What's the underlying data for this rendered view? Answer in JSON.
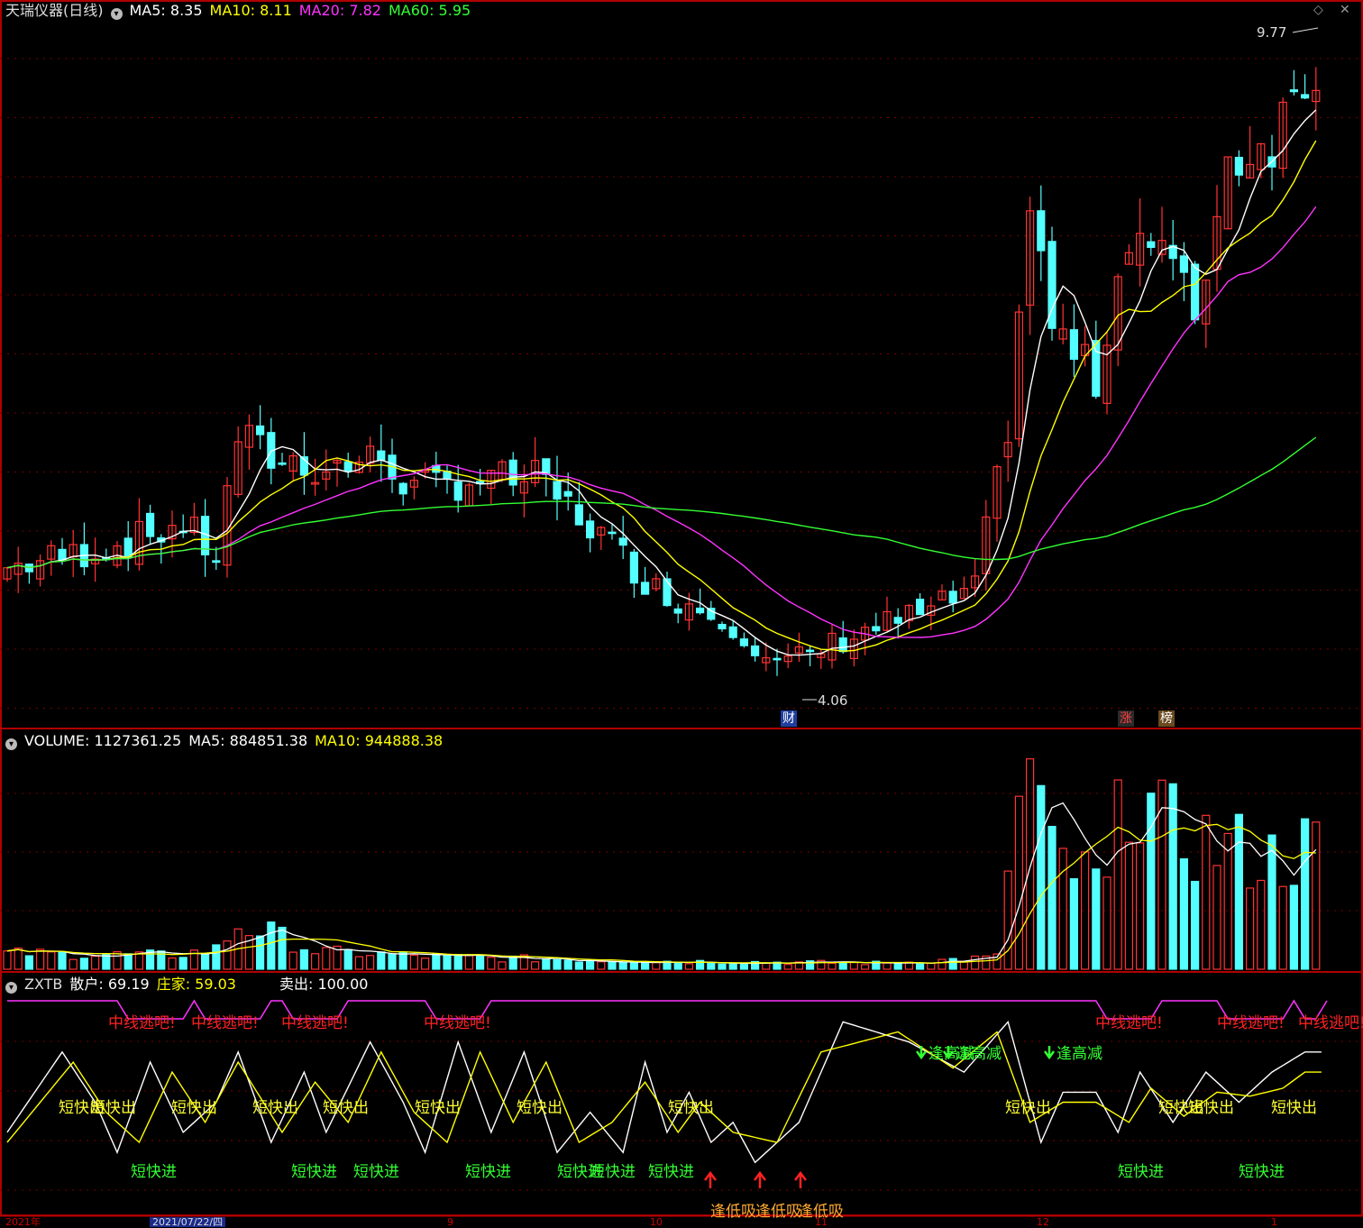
{
  "price_panel": {
    "title": "天瑞仪器(日线)",
    "indicators": [
      {
        "label": "MA5: 8.35",
        "color": "#ffffff"
      },
      {
        "label": "MA10: 8.11",
        "color": "#ffff00"
      },
      {
        "label": "MA20: 7.82",
        "color": "#ff33ff"
      },
      {
        "label": "MA60: 5.95",
        "color": "#33ff33"
      }
    ],
    "high_label": "9.77",
    "low_label": "4.06",
    "badge_cai": "财",
    "badge_zhang": "涨",
    "badge_bang": "榜"
  },
  "volume_panel": {
    "indicators": [
      {
        "label": "VOLUME: 1127361.25",
        "color": "#ffffff"
      },
      {
        "label": "MA5: 884851.38",
        "color": "#ffffff"
      },
      {
        "label": "MA10: 944888.38",
        "color": "#ffff00"
      }
    ]
  },
  "zxtb_panel": {
    "name": "ZXTB",
    "indicators": [
      {
        "label": "散户: 69.19",
        "color": "#ffffff"
      },
      {
        "label": "庄家: 59.03",
        "color": "#ffff00"
      },
      {
        "label": "卖出: 100.00",
        "color": "#ffffff"
      }
    ],
    "signal_escape": "中线逃吧!",
    "signal_short_out": "短快出",
    "signal_short_in": "短快进",
    "signal_reduce": "逢高减",
    "signal_low_buy": "逢低吸"
  },
  "x_axis": {
    "labels": [
      "2021年",
      "2021/07/22/四",
      "9",
      "10",
      "11",
      "12",
      "1"
    ]
  },
  "colors": {
    "up": "#ff3333",
    "down": "#54ffff",
    "ma5": "#ffffff",
    "ma10": "#ffff00",
    "ma20": "#ff33ff",
    "ma60": "#33ff33",
    "border": "#b00000",
    "signal_red": "#ff2222",
    "signal_yellow": "#ffff33",
    "signal_green": "#33ff33",
    "signal_magenta": "#ff33ff"
  },
  "chart_data": [
    {
      "type": "candlestick",
      "title": "天瑞仪器(日线)",
      "x_range": [
        0,
        120
      ],
      "ylim": [
        3.7,
        10.1
      ],
      "series_ma": [
        "MA5",
        "MA10",
        "MA20",
        "MA60"
      ],
      "price_high": 9.77,
      "price_low": 4.06,
      "close_anchors": [
        [
          0,
          5.1
        ],
        [
          10,
          5.3
        ],
        [
          16,
          5.5
        ],
        [
          19,
          5.2
        ],
        [
          21,
          6.3
        ],
        [
          24,
          6.1
        ],
        [
          29,
          6.0
        ],
        [
          34,
          6.1
        ],
        [
          37,
          5.8
        ],
        [
          42,
          5.9
        ],
        [
          48,
          5.9
        ],
        [
          54,
          5.4
        ],
        [
          59,
          4.9
        ],
        [
          66,
          4.6
        ],
        [
          70,
          4.2
        ],
        [
          73,
          4.3
        ],
        [
          77,
          4.5
        ],
        [
          84,
          4.7
        ],
        [
          88,
          4.9
        ],
        [
          91,
          6.4
        ],
        [
          93,
          8.4
        ],
        [
          95,
          7.3
        ],
        [
          99,
          6.8
        ],
        [
          102,
          8.2
        ],
        [
          105,
          8.0
        ],
        [
          108,
          7.4
        ],
        [
          111,
          8.8
        ],
        [
          115,
          9.0
        ],
        [
          118,
          9.6
        ]
      ]
    },
    {
      "type": "bar",
      "title": "VOLUME",
      "x_range": [
        0,
        120
      ],
      "volume_anchors": [
        [
          0,
          0.08
        ],
        [
          15,
          0.07
        ],
        [
          19,
          0.1
        ],
        [
          21,
          0.22
        ],
        [
          24,
          0.18
        ],
        [
          28,
          0.09
        ],
        [
          40,
          0.06
        ],
        [
          60,
          0.04
        ],
        [
          80,
          0.03
        ],
        [
          90,
          0.06
        ],
        [
          91,
          0.55
        ],
        [
          93,
          1.0
        ],
        [
          95,
          0.55
        ],
        [
          100,
          0.4
        ],
        [
          102,
          1.0
        ],
        [
          105,
          0.7
        ],
        [
          110,
          0.62
        ],
        [
          115,
          0.55
        ],
        [
          118,
          0.6
        ]
      ],
      "ylim": [
        0,
        1.05
      ]
    },
    {
      "type": "line",
      "title": "ZXTB",
      "series": [
        {
          "name": "散户",
          "anchors": [
            [
              0,
              40
            ],
            [
              5,
              80
            ],
            [
              8,
              55
            ],
            [
              10,
              30
            ],
            [
              13,
              75
            ],
            [
              16,
              40
            ],
            [
              19,
              55
            ],
            [
              21,
              80
            ],
            [
              24,
              35
            ],
            [
              27,
              70
            ],
            [
              29,
              40
            ],
            [
              33,
              85
            ],
            [
              36,
              55
            ],
            [
              38,
              30
            ],
            [
              41,
              85
            ],
            [
              44,
              40
            ],
            [
              47,
              80
            ],
            [
              50,
              30
            ],
            [
              53,
              50
            ],
            [
              56,
              30
            ],
            [
              58,
              75
            ],
            [
              60,
              40
            ],
            [
              62,
              60
            ],
            [
              64,
              35
            ],
            [
              66,
              45
            ],
            [
              68,
              25
            ],
            [
              72,
              45
            ],
            [
              76,
              95
            ],
            [
              82,
              85
            ],
            [
              87,
              70
            ],
            [
              91,
              95
            ],
            [
              94,
              35
            ],
            [
              96,
              60
            ],
            [
              99,
              60
            ],
            [
              101,
              40
            ],
            [
              103,
              70
            ],
            [
              106,
              45
            ],
            [
              109,
              70
            ],
            [
              112,
              55
            ],
            [
              115,
              70
            ],
            [
              118,
              80
            ]
          ]
        },
        {
          "name": "庄家",
          "anchors": [
            [
              0,
              35
            ],
            [
              6,
              75
            ],
            [
              9,
              50
            ],
            [
              12,
              35
            ],
            [
              15,
              70
            ],
            [
              18,
              45
            ],
            [
              21,
              75
            ],
            [
              25,
              40
            ],
            [
              28,
              65
            ],
            [
              31,
              45
            ],
            [
              34,
              80
            ],
            [
              37,
              50
            ],
            [
              40,
              35
            ],
            [
              43,
              80
            ],
            [
              46,
              45
            ],
            [
              49,
              75
            ],
            [
              52,
              35
            ],
            [
              55,
              45
            ],
            [
              58,
              65
            ],
            [
              61,
              40
            ],
            [
              63,
              55
            ],
            [
              66,
              40
            ],
            [
              70,
              35
            ],
            [
              74,
              80
            ],
            [
              81,
              90
            ],
            [
              86,
              72
            ],
            [
              90,
              90
            ],
            [
              93,
              45
            ],
            [
              96,
              55
            ],
            [
              99,
              55
            ],
            [
              102,
              45
            ],
            [
              104,
              62
            ],
            [
              107,
              48
            ],
            [
              110,
              60
            ],
            [
              113,
              58
            ],
            [
              116,
              62
            ],
            [
              118,
              70
            ]
          ]
        }
      ],
      "ylim": [
        0,
        110
      ]
    }
  ]
}
